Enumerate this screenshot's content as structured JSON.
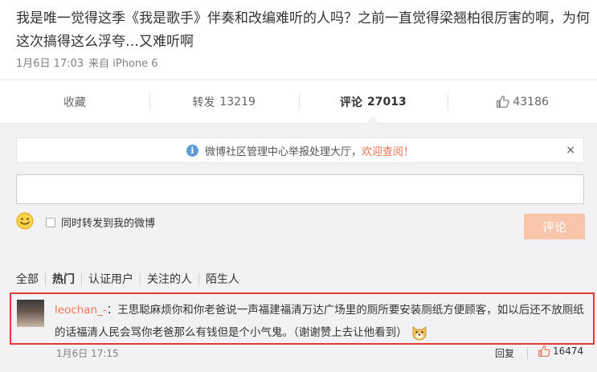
{
  "post": {
    "text": "我是唯一觉得这季《我是歌手》伴奏和改编难听的人吗？之前一直觉得梁翘柏很厉害的啊，为何这次搞得这么浮夸…又难听啊",
    "time": "1月6日 17:03",
    "source": "来自 iPhone 6"
  },
  "actions": {
    "favorite": "收藏",
    "repost_label": "转发",
    "repost_count": "13219",
    "comment_label": "评论",
    "comment_count": "27013",
    "like_count": "43186"
  },
  "notice": {
    "text": "微博社区管理中心举报处理大厅，",
    "link": "欢迎查阅！",
    "close": "×"
  },
  "composer": {
    "input_value": "",
    "forward_label": "同时转发到我的微博",
    "submit_label": "评论"
  },
  "filters": [
    "全部",
    "热门",
    "认证用户",
    "关注的人",
    "陌生人"
  ],
  "comment": {
    "user": "leochan_-",
    "text": "：王思聪麻烦你和你老爸说一声福建福清万达广场里的厕所要安装厕纸方便顾客，如以后还不放厕纸的话福清人民会骂你老爸那么有钱但是个小气鬼。（谢谢赞上去让他看到）",
    "time": "1月6日 17:15",
    "reply_label": "回复",
    "like_count": "16474"
  },
  "colors": {
    "accent": "#eb7350",
    "highlight_border": "#e53935",
    "panel_bg": "#f2f2f5",
    "submit_disabled": "#f7c5a9"
  },
  "icons": [
    "info-icon",
    "close-icon",
    "thumbs-up-icon",
    "smile-icon",
    "checkbox",
    "dog-emoji-icon",
    "avatar"
  ]
}
